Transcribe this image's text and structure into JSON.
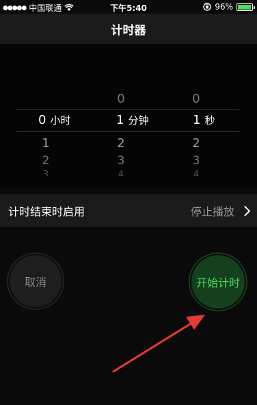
{
  "status_bar": {
    "carrier": "中国联通",
    "time": "下午5:40",
    "battery_percent": "96%",
    "battery_level": 0.96
  },
  "nav": {
    "title": "计时器"
  },
  "picker": {
    "hours": {
      "above": "",
      "selected": "0",
      "unit": "小时",
      "below": [
        "1",
        "2",
        "3"
      ]
    },
    "minutes": {
      "above": "0",
      "selected": "1",
      "unit": "分钟",
      "below": [
        "2",
        "3",
        "4"
      ]
    },
    "seconds": {
      "above": "0",
      "selected": "1",
      "unit": "秒",
      "below": [
        "2",
        "3",
        "4"
      ]
    }
  },
  "on_end_row": {
    "label": "计时结束时启用",
    "value": "停止播放"
  },
  "buttons": {
    "cancel": "取消",
    "start": "开始计时"
  },
  "colors": {
    "accent_green": "#4cd964",
    "arrow_red": "#e53935"
  }
}
